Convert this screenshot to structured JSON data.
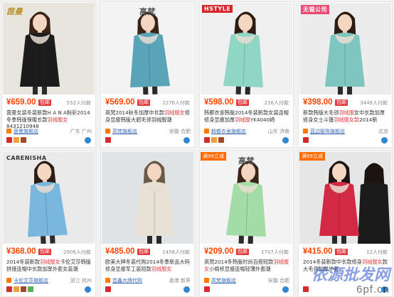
{
  "products": [
    {
      "brand_tag": "茵曼",
      "brand_style": "logo",
      "promo_tag": "",
      "price": "¥659.00",
      "sale_badge": "包邮",
      "sold": "552人付款",
      "title_pre": "茵曼女装冬装新款H A N A粉彩2014冬季韩版保暖长款",
      "title_hl": "羽绒服女",
      "title_post": "8431210948",
      "shop": "茵曼旗舰店",
      "location": "广东 广州",
      "colors": {
        "bg": "#e8e4de",
        "coat": "#1c1c1c",
        "hair": "#3a2418"
      },
      "icons": [
        "red",
        "gold",
        "brown"
      ]
    },
    {
      "brand_tag": "高梵",
      "brand_style": "plain",
      "promo_tag": "",
      "price": "¥569.00",
      "sale_badge": "包邮",
      "sold": "2276人付款",
      "title_pre": "高梵2014秋冬加厚中长款",
      "title_hl": "羽绒服女",
      "title_post": "修身显瘦韩版大貂毛领羽绒服潮",
      "shop": "高梵旗舰店",
      "location": "安徽 合肥",
      "colors": {
        "bg": "#f3f3f3",
        "coat": "#5aa4b8",
        "hair": "#3a2418"
      },
      "icons": [
        "red"
      ]
    },
    {
      "brand_tag": "HSTYLE",
      "brand_style": "box",
      "promo_tag": "",
      "price": "¥598.00",
      "sale_badge": "包邮",
      "sold": "216人付款",
      "title_pre": "韩都衣舍韩版2014冬装新款女装连帽修身显瘦加厚",
      "title_hl": "羽绒服",
      "title_post": "YK4040崎",
      "shop": "韩都衣舍旗舰店",
      "location": "山东 济南",
      "colors": {
        "bg": "#f0f0f0",
        "coat": "#8fd6c4",
        "hair": "#2c1c14"
      },
      "icons": [
        "red",
        "gold",
        "brown"
      ]
    },
    {
      "brand_tag": "无锡公司",
      "brand_style": "box-pink",
      "promo_tag": "",
      "price": "¥398.00",
      "sale_badge": "包邮",
      "sold": "3449人付款",
      "title_pre": "新款韩版大毛领",
      "title_hl": "羽绒服",
      "title_post": "女中长款加厚修身女士斗篷",
      "title_hl2": "羽绒服女款",
      "title_post2": "2014新",
      "shop": "蓝边服饰旗舰店",
      "location": "北京",
      "colors": {
        "bg": "#ececec",
        "coat": "#7fc6c0",
        "hair": "#2c1c14"
      },
      "icons": [
        "red"
      ]
    },
    {
      "brand_tag": "CARENISHA",
      "brand_style": "plain-dark",
      "promo_tag": "",
      "price": "¥368.00",
      "sale_badge": "包邮",
      "sold": "2906人付款",
      "title_pre": "2014冬装新款",
      "title_hl": "羽绒服女",
      "title_post": "卡伦艾莎韩版拼接连帽中长款加厚外套女装潮",
      "shop": "卡伦艾莎旗舰店",
      "location": "浙江 杭州",
      "colors": {
        "bg": "#eaeaea",
        "coat": "#7ab7df",
        "hair": "#2c1c14"
      },
      "icons": [
        "red",
        "gold",
        "brown",
        "green"
      ]
    },
    {
      "brand_tag": "",
      "brand_style": "none",
      "promo_tag": "",
      "price": "¥485.00",
      "sale_badge": "包邮",
      "sold": "1458人付款",
      "title_pre": "欧美大牌冬装代购2014冬季新品大码修身显瘦军工装短款",
      "title_hl": "羽绒服女",
      "title_post": "",
      "shop": "芸鑫大牌代购",
      "location": "香港 新界",
      "colors": {
        "bg": "#dfe3e5",
        "coat": "#e8e2d6",
        "hair": "#6a5a4a"
      },
      "icons": [
        "red"
      ]
    },
    {
      "brand_tag": "高梵",
      "brand_style": "plain",
      "promo_tag": "满99立减",
      "price": "¥209.00",
      "sale_badge": "包邮",
      "sold": "1707人付款",
      "title_pre": "高梵2014冬韩版时尚百搭短款",
      "title_hl": "羽绒服女",
      "title_post": "小棉袄显瘦连帽轻薄外套潮",
      "shop": "高梵旗舰店",
      "location": "安徽 合肥",
      "colors": {
        "bg": "#f3f3f3",
        "coat": "#a4dca8",
        "hair": "#3a2418"
      },
      "icons": [
        "red"
      ]
    },
    {
      "brand_tag": "",
      "brand_style": "none",
      "promo_tag": "满99立减",
      "price": "¥415.00",
      "sale_badge": "包邮",
      "sold": "12人付款",
      "title_pre": "2014冬装新款中长款修身",
      "title_hl": "羽绒服女",
      "title_post": "款大毛领加厚外套",
      "shop": "",
      "location": "",
      "colors": {
        "bg": "#e6e6e6",
        "coat": "#d22a44",
        "hair": "#1c1410"
      },
      "icons": [
        "red"
      ]
    }
  ],
  "watermark": {
    "line1": "依源批发网",
    "line2": "6pf.cn"
  }
}
